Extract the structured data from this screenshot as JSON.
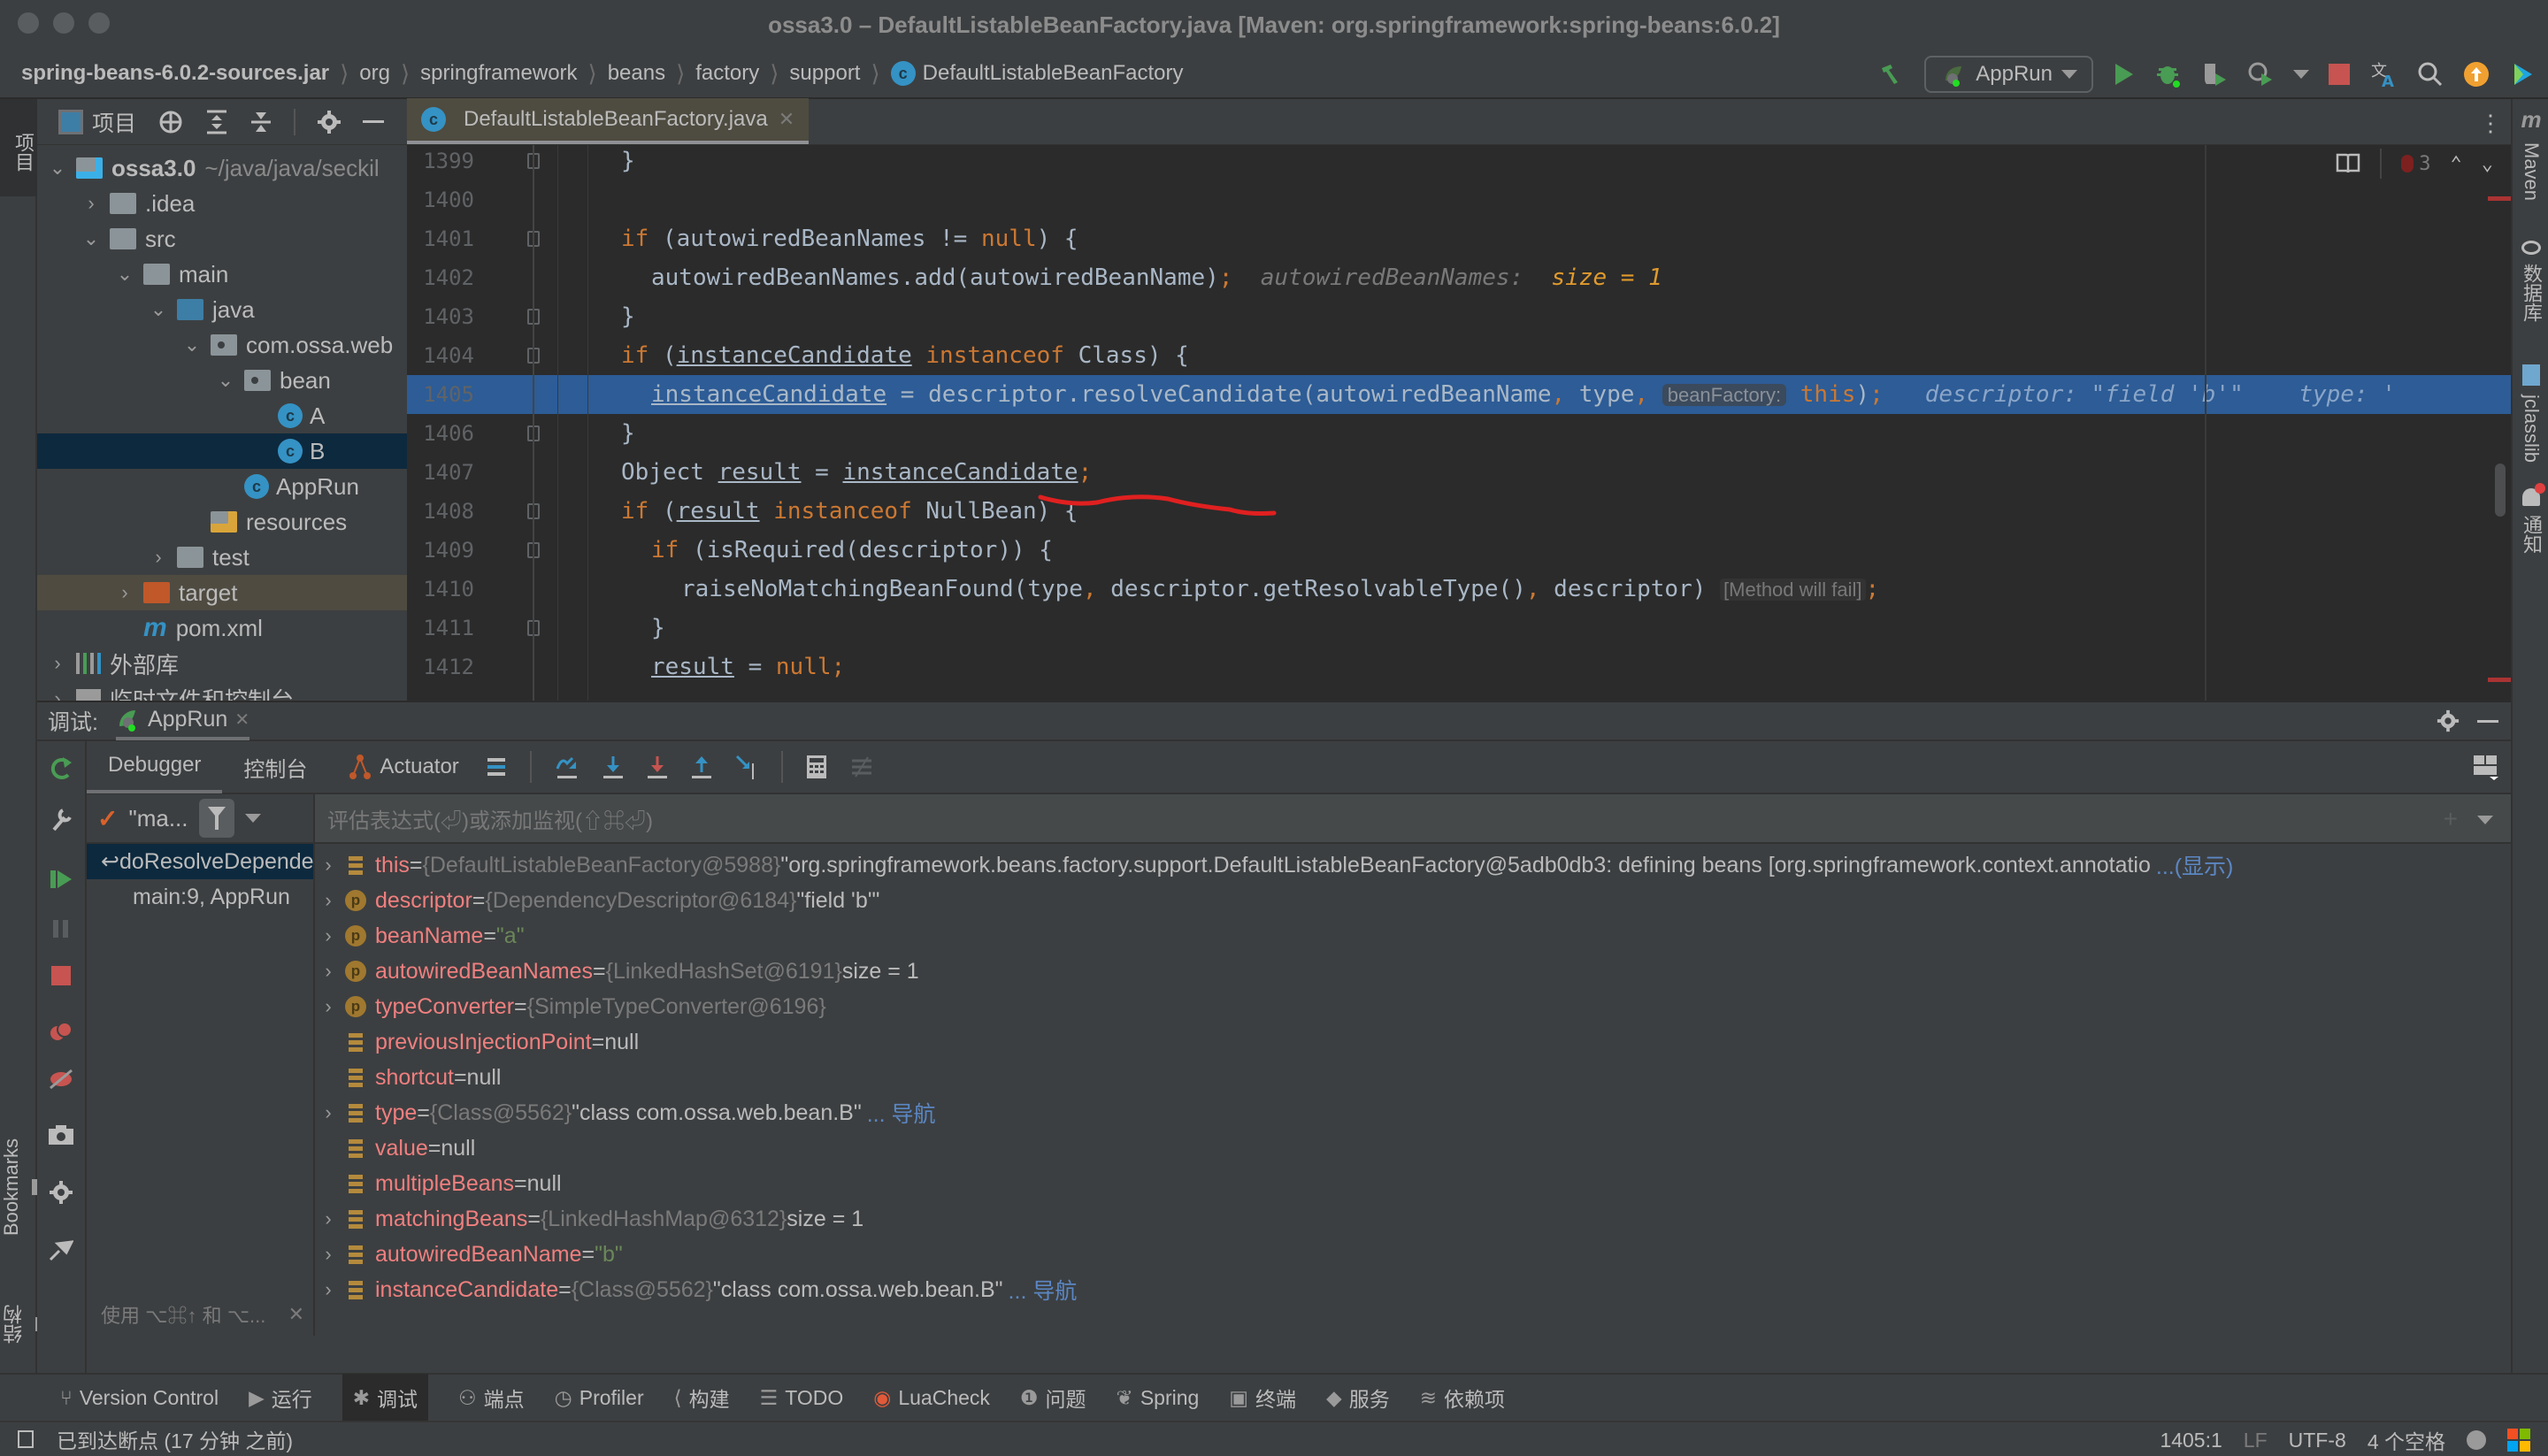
{
  "window": {
    "title": "ossa3.0 – DefaultListableBeanFactory.java [Maven: org.springframework:spring-beans:6.0.2]"
  },
  "breadcrumb": [
    "spring-beans-6.0.2-sources.jar",
    "org",
    "springframework",
    "beans",
    "factory",
    "support",
    "DefaultListableBeanFactory"
  ],
  "toolbar": {
    "run_config": "AppRun",
    "icons": [
      "hammer-icon",
      "run-icon",
      "debug-icon",
      "coverage-icon",
      "profile-icon",
      "stop-icon",
      "translate-icon",
      "search-icon",
      "update-icon",
      "toolbox-icon"
    ]
  },
  "left_strip": {
    "project_tab": "项目"
  },
  "project": {
    "header_label": "项目",
    "tree": [
      {
        "label": "ossa3.0",
        "suffix": "~/java/java/seckil",
        "depth": 0,
        "expanded": true,
        "icon": "module"
      },
      {
        "label": ".idea",
        "depth": 1,
        "expanded": false,
        "icon": "folder"
      },
      {
        "label": "src",
        "depth": 1,
        "expanded": true,
        "icon": "folder"
      },
      {
        "label": "main",
        "depth": 2,
        "expanded": true,
        "icon": "folder"
      },
      {
        "label": "java",
        "depth": 3,
        "expanded": true,
        "icon": "folder-blue"
      },
      {
        "label": "com.ossa.web",
        "depth": 4,
        "expanded": true,
        "icon": "package"
      },
      {
        "label": "bean",
        "depth": 5,
        "expanded": true,
        "icon": "package"
      },
      {
        "label": "A",
        "depth": 6,
        "icon": "class"
      },
      {
        "label": "B",
        "depth": 6,
        "icon": "class",
        "selected": true
      },
      {
        "label": "AppRun",
        "depth": 5,
        "icon": "spring-class"
      },
      {
        "label": "resources",
        "depth": 4,
        "icon": "resources-folder"
      },
      {
        "label": "test",
        "depth": 3,
        "expanded": false,
        "icon": "folder"
      },
      {
        "label": "target",
        "depth": 2,
        "expanded": false,
        "icon": "folder-orange",
        "excluded": true
      },
      {
        "label": "pom.xml",
        "depth": 2,
        "icon": "maven"
      },
      {
        "label": "外部库",
        "depth": 0,
        "expanded": false,
        "icon": "library"
      },
      {
        "label": "临时文件和控制台",
        "depth": 0,
        "expanded": false,
        "icon": "scratch"
      }
    ]
  },
  "editor": {
    "tab_label": "DefaultListableBeanFactory.java",
    "problems_count": "3",
    "current_line": 1405,
    "lines": [
      {
        "num": "1399",
        "indent": 3,
        "html": "}"
      },
      {
        "num": "1400",
        "indent": 0,
        "html": ""
      },
      {
        "num": "1401",
        "indent": 3,
        "html": "<span class='kw'>if</span> (autowiredBeanNames != <span class='kw'>null</span>) {"
      },
      {
        "num": "1402",
        "indent": 4,
        "html": "autowiredBeanNames.add(autowiredBeanName)<span class='kw'>;</span>  <span class='hint'>autowiredBeanNames:</span>  <span class='hintv'>size = 1</span>"
      },
      {
        "num": "1403",
        "indent": 3,
        "html": "}"
      },
      {
        "num": "1404",
        "indent": 3,
        "html": "<span class='kw'>if</span> (<span class='ul'>instanceCandidate</span> <span class='kw'>instanceof</span> Class) {"
      },
      {
        "num": "1405",
        "indent": 4,
        "html": "<span class='ul'>instanceCandidate</span> = descriptor.resolveCandidate(autowiredBeanName<span class='kw'>,</span> type<span class='kw'>,</span> <span class='inlay'>beanFactory:</span> <span class='kw'>this</span>)<span class='kw'>;</span>   <span class='hint' style='color:#8aa5c8'>descriptor: </span><span class='hint' style='color:#8aa5c8'>\"field 'b'\"</span>    <span class='hint' style='color:#8aa5c8'>type: '</span>",
        "highlight": true
      },
      {
        "num": "1406",
        "indent": 3,
        "html": "}"
      },
      {
        "num": "1407",
        "indent": 3,
        "html": "Object <span class='ul'>result</span> = <span class='ul'>instanceCandidate</span><span class='kw'>;</span>"
      },
      {
        "num": "1408",
        "indent": 3,
        "html": "<span class='kw'>if</span> (<span class='ul'>result</span> <span class='kw'>instanceof</span> NullBean) {"
      },
      {
        "num": "1409",
        "indent": 4,
        "html": "<span class='kw'>if</span> (isRequired(descriptor)) {"
      },
      {
        "num": "1410",
        "indent": 5,
        "html": "raiseNoMatchingBeanFound(type<span class='kw'>,</span> descriptor.getResolvableType()<span class='kw'>,</span> descriptor) <span class='failhint'>[Method will fail]</span><span class='kw'>;</span>"
      },
      {
        "num": "1411",
        "indent": 4,
        "html": "}"
      },
      {
        "num": "1412",
        "indent": 4,
        "html": "<span class='ul'>result</span> = <span class='kw'>null;</span>"
      }
    ]
  },
  "right_strip": {
    "tabs": [
      "Maven",
      "数据库",
      "jclasslib",
      "通知"
    ]
  },
  "debug": {
    "label": "调试:",
    "session_tab": "AppRun",
    "tabs": [
      "Debugger",
      "控制台",
      "Actuator"
    ],
    "thread_label": "\"ma...",
    "eval_placeholder": "评估表达式(⏎)或添加监视(⇧⌘⏎)",
    "frames": [
      {
        "label": "doResolveDependency",
        "selected": true
      },
      {
        "label": "main:9, AppRun"
      }
    ],
    "frames_hint": "使用 ⌥⌘↑ 和 ⌥...",
    "variables": [
      {
        "expand": true,
        "icon": "field",
        "name": "this",
        "type": "{DefaultListableBeanFactory@5988}",
        "value": "\"org.springframework.beans.factory.support.DefaultListableBeanFactory@5adb0db3: defining beans [org.springframework.context.annotatio",
        "link": "...(显示)"
      },
      {
        "expand": true,
        "icon": "param",
        "name": "descriptor",
        "type": "{DependencyDescriptor@6184}",
        "value": "\"field 'b'\""
      },
      {
        "expand": true,
        "icon": "param",
        "name": "beanName",
        "str": "\"a\""
      },
      {
        "expand": true,
        "icon": "param",
        "name": "autowiredBeanNames",
        "type": "{LinkedHashSet@6191}",
        "value": " size = 1"
      },
      {
        "expand": true,
        "icon": "param",
        "name": "typeConverter",
        "type": "{SimpleTypeConverter@6196}"
      },
      {
        "expand": false,
        "icon": "field",
        "name": "previousInjectionPoint",
        "value": "null"
      },
      {
        "expand": false,
        "icon": "field",
        "name": "shortcut",
        "value": "null"
      },
      {
        "expand": true,
        "icon": "field",
        "name": "type",
        "type": "{Class@5562}",
        "value": "\"class com.ossa.web.bean.B\"",
        "link": "... 导航"
      },
      {
        "expand": false,
        "icon": "field",
        "name": "value",
        "value": "null"
      },
      {
        "expand": false,
        "icon": "field",
        "name": "multipleBeans",
        "value": "null"
      },
      {
        "expand": true,
        "icon": "field",
        "name": "matchingBeans",
        "type": "{LinkedHashMap@6312}",
        "value": " size = 1"
      },
      {
        "expand": true,
        "icon": "field",
        "name": "autowiredBeanName",
        "str": "\"b\""
      },
      {
        "expand": true,
        "icon": "field",
        "name": "instanceCandidate",
        "type": "{Class@5562}",
        "value": "\"class com.ossa.web.bean.B\"",
        "link": "... 导航"
      }
    ]
  },
  "left_bottom_tabs": [
    "Bookmarks",
    "结构"
  ],
  "bottom_tools": [
    "Version Control",
    "运行",
    "调试",
    "端点",
    "Profiler",
    "构建",
    "TODO",
    "LuaCheck",
    "问题",
    "Spring",
    "终端",
    "服务",
    "依赖项"
  ],
  "bottom_active": "调试",
  "status": {
    "message": "已到达断点 (17 分钟 之前)",
    "position": "1405:1",
    "line_sep": "LF",
    "encoding": "UTF-8",
    "indent": "4 个空格"
  },
  "colors": {
    "accent_blue": "#2d5c96",
    "selection_dark": "#0d293e",
    "keyword": "#cc7832",
    "var_name": "#f07f7f",
    "string": "#6a8759",
    "link": "#5b87c4",
    "stop_red": "#c75450",
    "run_green": "#499c54"
  }
}
